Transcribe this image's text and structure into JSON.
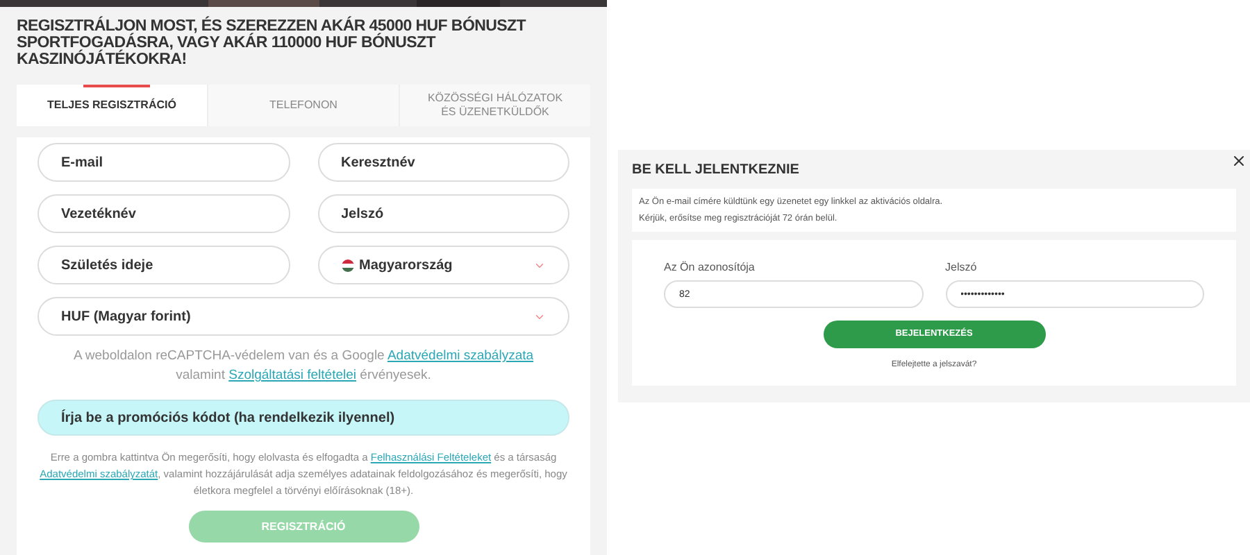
{
  "registration": {
    "title": "REGISZTRÁLJON MOST, ÉS SZEREZZEN AKÁR 45000 HUF BÓNUSZT SPORTFOGADÁSRA, VAGY AKÁR 110000 HUF BÓNUSZT KASZINÓJÁTÉKOKRA!",
    "tabs": [
      {
        "label": "TELJES REGISZTRÁCIÓ",
        "selected": true
      },
      {
        "label": "TELEFONON",
        "selected": false
      },
      {
        "label": "KÖZÖSSÉGI HÁLÓZATOK ÉS ÜZENETKÜLDŐK",
        "selected": false
      }
    ],
    "fields": [
      {
        "kind": "text",
        "placeholder": "E-mail"
      },
      {
        "kind": "text",
        "placeholder": "Keresztnév"
      },
      {
        "kind": "text",
        "placeholder": "Vezetéknév"
      },
      {
        "kind": "text",
        "placeholder": "Jelszó"
      },
      {
        "kind": "text",
        "placeholder": "Születés ideje"
      },
      {
        "kind": "country",
        "value": "Magyarország"
      }
    ],
    "currency": "HUF (Magyar forint)",
    "recaptcha_note": [
      {
        "kind": "text",
        "text": "A weboldalon reCAPTCHA-védelem van és a Google "
      },
      {
        "kind": "link",
        "text": "Adatvédelmi szabályzata"
      },
      {
        "kind": "text",
        "text": " valamint "
      },
      {
        "kind": "link",
        "text": "Szolgáltatási feltételei"
      },
      {
        "kind": "text",
        "text": " érvényesek."
      }
    ],
    "promo_code": {
      "placeholder": "Írja be a promóciós kódot (ha rendelkezik ilyennel)"
    },
    "consent_note": [
      {
        "kind": "text",
        "text": "Erre a gombra kattintva Ön megerősíti, hogy elolvasta és elfogadta a "
      },
      {
        "kind": "link",
        "text": "Felhasználási Feltételeket"
      },
      {
        "kind": "text",
        "text": " és a társaság "
      },
      {
        "kind": "link",
        "text": "Adatvédelmi szabályzatát"
      },
      {
        "kind": "text",
        "text": ", valamint hozzájárulását adja személyes adatainak feldolgozásához és megerősíti, hogy életkora megfelel a törvényi előírásoknak (18+)."
      }
    ],
    "submit": {
      "label": "REGISZTRÁCIÓ",
      "disabled": true
    }
  },
  "login_dialog": {
    "title": "BE KELL JELENTKEZNIE",
    "messages": [
      "Az Ön e-mail címére küldtünk egy üzenetet egy linkkel az aktivációs oldalra.",
      "Kérjük, erősítse meg regisztrációját 72 órán belül."
    ],
    "fields": [
      {
        "label": "Az Ön azonosítója",
        "value": "82"
      },
      {
        "label": "Jelszó",
        "value": "•••••••••••••"
      }
    ],
    "submit": "BEJELENTKEZÉS",
    "forgot_link": "Elfelejtette a jelszavát?"
  }
}
